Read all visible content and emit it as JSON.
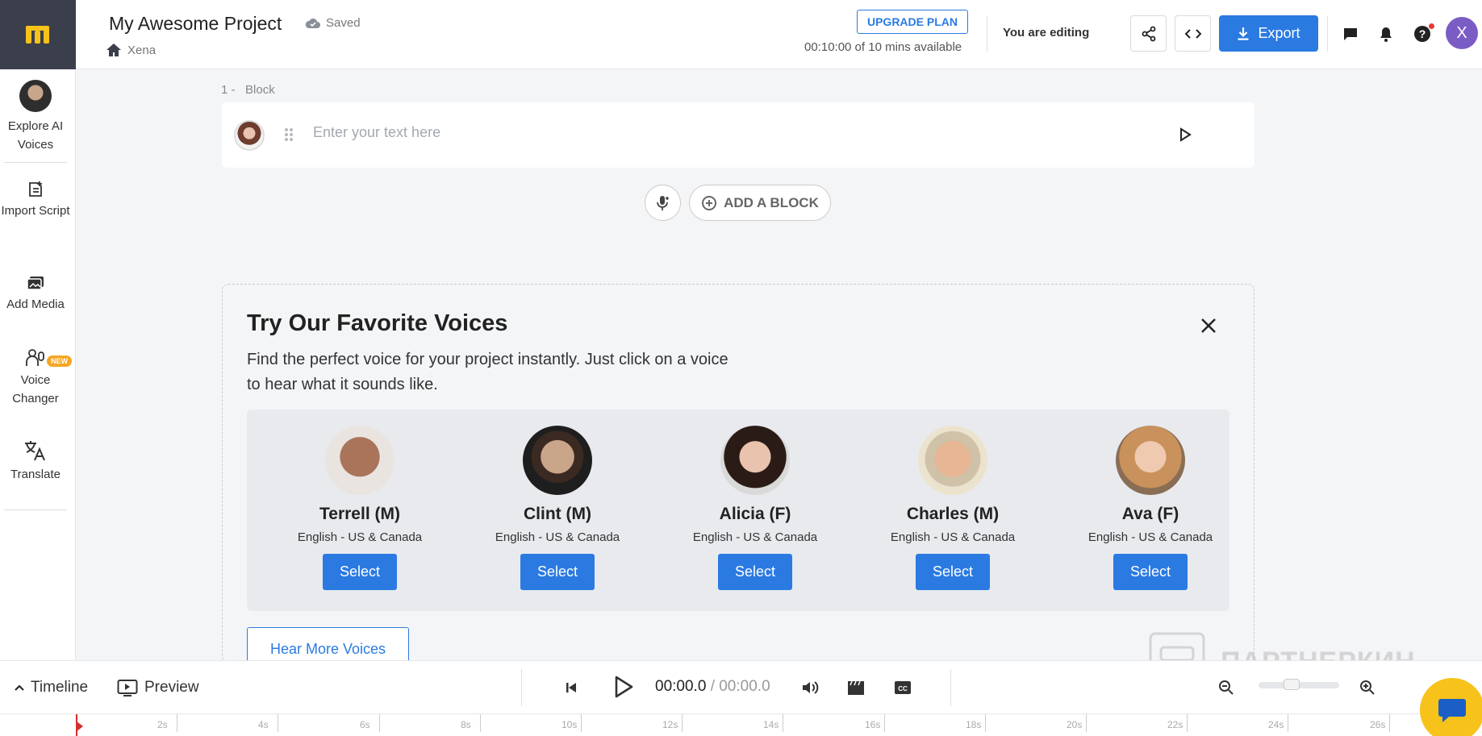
{
  "header": {
    "project_title": "My Awesome Project",
    "save_status": "Saved",
    "breadcrumb_workspace": "Xena",
    "upgrade_label": "UPGRADE PLAN",
    "minutes_available": "00:10:00 of 10 mins available",
    "editing_status": "You are editing",
    "export_label": "Export",
    "user_initial": "X",
    "accent_color": "#2a7ae2"
  },
  "sidebar": {
    "items": [
      {
        "label": "Explore AI Voices",
        "icon": "voice-avatar"
      },
      {
        "label": "Import Script",
        "icon": "import-script-icon"
      },
      {
        "label": "Add Media",
        "icon": "add-media-icon"
      },
      {
        "label": "Voice Changer",
        "icon": "voice-changer-icon"
      },
      {
        "label": "Translate",
        "icon": "translate-icon",
        "badge": "NEW"
      }
    ]
  },
  "editor": {
    "block_number": "1 -",
    "block_label": "Block",
    "text_placeholder": "Enter your text here",
    "add_block_label": "ADD A BLOCK"
  },
  "favorites": {
    "title": "Try Our Favorite Voices",
    "description": "Find the perfect voice for your project instantly. Just click on a voice to hear what it sounds like.",
    "voices": [
      {
        "name": "Terrell (M)",
        "lang": "English - US & Canada",
        "button": "Select"
      },
      {
        "name": "Clint (M)",
        "lang": "English - US & Canada",
        "button": "Select"
      },
      {
        "name": "Alicia (F)",
        "lang": "English - US & Canada",
        "button": "Select"
      },
      {
        "name": "Charles (M)",
        "lang": "English - US & Canada",
        "button": "Select"
      },
      {
        "name": "Ava (F)",
        "lang": "English - US & Canada",
        "button": "Select"
      }
    ],
    "hear_more_label": "Hear More Voices"
  },
  "bottombar": {
    "timeline_label": "Timeline",
    "preview_label": "Preview",
    "current_time": "00:00.0",
    "total_time": "/ 00:00.0"
  },
  "ruler": {
    "labels": [
      "2s",
      "4s",
      "6s",
      "8s",
      "10s",
      "12s",
      "14s",
      "16s",
      "18s",
      "20s",
      "22s",
      "24s",
      "26s"
    ]
  },
  "watermark": {
    "text": "ПАРТНЕРКИН"
  }
}
